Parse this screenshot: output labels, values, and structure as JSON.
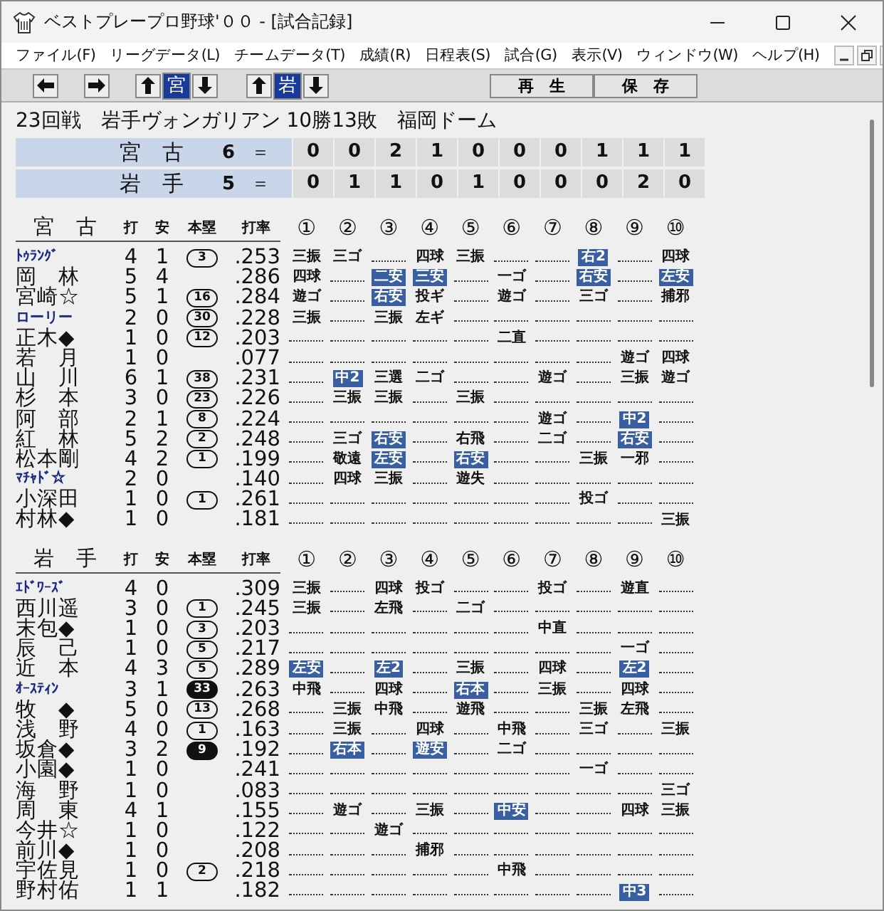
{
  "window": {
    "title": "ベストプレープロ野球'００ - [試合記録]"
  },
  "menu": {
    "items": [
      "ファイル(F)",
      "リーグデータ(L)",
      "チームデータ(T)",
      "成績(R)",
      "日程表(S)",
      "試合(G)",
      "表示(V)",
      "ウィンドウ(W)",
      "ヘルプ(H)"
    ]
  },
  "toolbar": {
    "teams": [
      {
        "label": "宮",
        "selected": true
      },
      {
        "label": "岩",
        "selected": true
      }
    ],
    "buttons": [
      "再　生",
      "保　存"
    ]
  },
  "game": {
    "header": "23回戦　岩手ヴォンガリアン 10勝13敗　福岡ドーム",
    "linescore": [
      {
        "team": "宮　古",
        "total": "6",
        "sign": "＝",
        "innings": [
          "0",
          "0",
          "2",
          "1",
          "0",
          "0",
          "0",
          "1",
          "1",
          "1"
        ]
      },
      {
        "team": "岩　手",
        "total": "5",
        "sign": "＝",
        "innings": [
          "0",
          "1",
          "1",
          "0",
          "1",
          "0",
          "0",
          "0",
          "2",
          "0"
        ]
      }
    ]
  },
  "batting": [
    {
      "team": "宮　古",
      "columns": [
        "打",
        "安",
        "本塁",
        "打率"
      ],
      "innings": [
        "①",
        "②",
        "③",
        "④",
        "⑤",
        "⑥",
        "⑦",
        "⑧",
        "⑨",
        "⑩"
      ],
      "players": [
        {
          "name": "ﾄｩﾗﾝｸﾞ",
          "foreign": true,
          "ab": "4",
          "h": "1",
          "hr": {
            "count": "3",
            "filled": false
          },
          "avg": ".253",
          "results": [
            {
              "kind": "out",
              "text": "三振"
            },
            {
              "kind": "out",
              "text": "三ゴ"
            },
            {
              "kind": "blank"
            },
            {
              "kind": "out",
              "text": "四球"
            },
            {
              "kind": "out",
              "text": "三振"
            },
            {
              "kind": "blank"
            },
            {
              "kind": "blank"
            },
            {
              "kind": "hit",
              "text": "右2"
            },
            {
              "kind": "blank"
            },
            {
              "kind": "out",
              "text": "四球"
            }
          ]
        },
        {
          "name": "岡　林",
          "foreign": false,
          "ab": "5",
          "h": "4",
          "avg": ".286",
          "results": [
            {
              "kind": "out",
              "text": "四球"
            },
            {
              "kind": "blank"
            },
            {
              "kind": "hit",
              "text": "二安"
            },
            {
              "kind": "hit",
              "text": "三安"
            },
            {
              "kind": "blank"
            },
            {
              "kind": "out",
              "text": "一ゴ"
            },
            {
              "kind": "blank"
            },
            {
              "kind": "hit",
              "text": "右安"
            },
            {
              "kind": "blank"
            },
            {
              "kind": "hit",
              "text": "左安"
            }
          ]
        },
        {
          "name": "宮崎☆",
          "foreign": false,
          "ab": "5",
          "h": "1",
          "hr": {
            "count": "16",
            "filled": false
          },
          "avg": ".284",
          "results": [
            {
              "kind": "out",
              "text": "遊ゴ"
            },
            {
              "kind": "blank"
            },
            {
              "kind": "hit",
              "text": "右安"
            },
            {
              "kind": "out",
              "text": "投ギ"
            },
            {
              "kind": "blank"
            },
            {
              "kind": "out",
              "text": "遊ゴ"
            },
            {
              "kind": "blank"
            },
            {
              "kind": "out",
              "text": "三ゴ"
            },
            {
              "kind": "blank"
            },
            {
              "kind": "out",
              "text": "捕邪"
            }
          ]
        },
        {
          "name": "ローリー",
          "foreign": true,
          "ab": "2",
          "h": "0",
          "hr": {
            "count": "30",
            "filled": false
          },
          "avg": ".228",
          "results": [
            {
              "kind": "out",
              "text": "三振"
            },
            {
              "kind": "blank"
            },
            {
              "kind": "out",
              "text": "三振"
            },
            {
              "kind": "out",
              "text": "左ギ"
            },
            {
              "kind": "blank"
            },
            {
              "kind": "blank"
            },
            {
              "kind": "blank"
            },
            {
              "kind": "blank"
            },
            {
              "kind": "blank"
            },
            {
              "kind": "blank"
            }
          ]
        },
        {
          "name": "正木◆",
          "foreign": false,
          "ab": "1",
          "h": "0",
          "hr": {
            "count": "12",
            "filled": false
          },
          "avg": ".203",
          "results": [
            {
              "kind": "blank"
            },
            {
              "kind": "blank"
            },
            {
              "kind": "blank"
            },
            {
              "kind": "blank"
            },
            {
              "kind": "blank"
            },
            {
              "kind": "out",
              "text": "二直"
            },
            {
              "kind": "blank"
            },
            {
              "kind": "blank"
            },
            {
              "kind": "blank"
            },
            {
              "kind": "blank"
            }
          ]
        },
        {
          "name": "若　月",
          "foreign": false,
          "ab": "1",
          "h": "0",
          "avg": ".077",
          "results": [
            {
              "kind": "blank"
            },
            {
              "kind": "blank"
            },
            {
              "kind": "blank"
            },
            {
              "kind": "blank"
            },
            {
              "kind": "blank"
            },
            {
              "kind": "blank"
            },
            {
              "kind": "blank"
            },
            {
              "kind": "blank"
            },
            {
              "kind": "out",
              "text": "遊ゴ"
            },
            {
              "kind": "out",
              "text": "四球"
            }
          ]
        },
        {
          "name": "山　川",
          "foreign": false,
          "ab": "6",
          "h": "1",
          "hr": {
            "count": "38",
            "filled": false
          },
          "avg": ".231",
          "results": [
            {
              "kind": "blank"
            },
            {
              "kind": "hit",
              "text": "中2"
            },
            {
              "kind": "out",
              "text": "三選"
            },
            {
              "kind": "out",
              "text": "二ゴ"
            },
            {
              "kind": "blank"
            },
            {
              "kind": "blank"
            },
            {
              "kind": "out",
              "text": "遊ゴ"
            },
            {
              "kind": "blank"
            },
            {
              "kind": "out",
              "text": "三振"
            },
            {
              "kind": "out",
              "text": "遊ゴ"
            }
          ]
        },
        {
          "name": "杉　本",
          "foreign": false,
          "ab": "3",
          "h": "0",
          "hr": {
            "count": "23",
            "filled": false
          },
          "avg": ".226",
          "results": [
            {
              "kind": "blank"
            },
            {
              "kind": "out",
              "text": "三振"
            },
            {
              "kind": "out",
              "text": "三振"
            },
            {
              "kind": "blank"
            },
            {
              "kind": "out",
              "text": "三振"
            },
            {
              "kind": "blank"
            },
            {
              "kind": "blank"
            },
            {
              "kind": "blank"
            },
            {
              "kind": "blank"
            },
            {
              "kind": "blank"
            }
          ]
        },
        {
          "name": "阿　部",
          "foreign": false,
          "ab": "2",
          "h": "1",
          "hr": {
            "count": "8",
            "filled": false
          },
          "avg": ".224",
          "results": [
            {
              "kind": "blank"
            },
            {
              "kind": "blank"
            },
            {
              "kind": "blank"
            },
            {
              "kind": "blank"
            },
            {
              "kind": "blank"
            },
            {
              "kind": "blank"
            },
            {
              "kind": "out",
              "text": "遊ゴ"
            },
            {
              "kind": "blank"
            },
            {
              "kind": "hit",
              "text": "中2"
            },
            {
              "kind": "blank"
            }
          ]
        },
        {
          "name": "紅　林",
          "foreign": false,
          "ab": "5",
          "h": "2",
          "hr": {
            "count": "2",
            "filled": false
          },
          "avg": ".248",
          "results": [
            {
              "kind": "blank"
            },
            {
              "kind": "out",
              "text": "三ゴ"
            },
            {
              "kind": "hit",
              "text": "右安"
            },
            {
              "kind": "blank"
            },
            {
              "kind": "out",
              "text": "右飛"
            },
            {
              "kind": "blank"
            },
            {
              "kind": "out",
              "text": "二ゴ"
            },
            {
              "kind": "blank"
            },
            {
              "kind": "hit",
              "text": "右安"
            },
            {
              "kind": "blank"
            }
          ]
        },
        {
          "name": "松本剛",
          "foreign": false,
          "ab": "4",
          "h": "2",
          "hr": {
            "count": "1",
            "filled": false
          },
          "avg": ".199",
          "results": [
            {
              "kind": "blank"
            },
            {
              "kind": "out",
              "text": "敬遠"
            },
            {
              "kind": "hit",
              "text": "左安"
            },
            {
              "kind": "blank"
            },
            {
              "kind": "hit",
              "text": "右安"
            },
            {
              "kind": "blank"
            },
            {
              "kind": "blank"
            },
            {
              "kind": "out",
              "text": "三振"
            },
            {
              "kind": "out",
              "text": "一邪"
            },
            {
              "kind": "blank"
            }
          ]
        },
        {
          "name": "ﾏﾁｬﾄﾞ☆",
          "foreign": true,
          "ab": "2",
          "h": "0",
          "avg": ".140",
          "results": [
            {
              "kind": "blank"
            },
            {
              "kind": "out",
              "text": "四球"
            },
            {
              "kind": "out",
              "text": "三振"
            },
            {
              "kind": "blank"
            },
            {
              "kind": "out",
              "text": "遊失"
            },
            {
              "kind": "blank"
            },
            {
              "kind": "blank"
            },
            {
              "kind": "blank"
            },
            {
              "kind": "blank"
            },
            {
              "kind": "blank"
            }
          ]
        },
        {
          "name": "小深田",
          "foreign": false,
          "ab": "1",
          "h": "0",
          "hr": {
            "count": "1",
            "filled": false
          },
          "avg": ".261",
          "results": [
            {
              "kind": "blank"
            },
            {
              "kind": "blank"
            },
            {
              "kind": "blank"
            },
            {
              "kind": "blank"
            },
            {
              "kind": "blank"
            },
            {
              "kind": "blank"
            },
            {
              "kind": "blank"
            },
            {
              "kind": "out",
              "text": "投ゴ"
            },
            {
              "kind": "blank"
            },
            {
              "kind": "blank"
            }
          ]
        },
        {
          "name": "村林◆",
          "foreign": false,
          "ab": "1",
          "h": "0",
          "avg": ".181",
          "results": [
            {
              "kind": "blank"
            },
            {
              "kind": "blank"
            },
            {
              "kind": "blank"
            },
            {
              "kind": "blank"
            },
            {
              "kind": "blank"
            },
            {
              "kind": "blank"
            },
            {
              "kind": "blank"
            },
            {
              "kind": "blank"
            },
            {
              "kind": "blank"
            },
            {
              "kind": "out",
              "text": "三振"
            }
          ]
        }
      ]
    },
    {
      "team": "岩　手",
      "columns": [
        "打",
        "安",
        "本塁",
        "打率"
      ],
      "innings": [
        "①",
        "②",
        "③",
        "④",
        "⑤",
        "⑥",
        "⑦",
        "⑧",
        "⑨",
        "⑩"
      ],
      "players": [
        {
          "name": "ｴﾄﾞﾜｰｽﾞ",
          "foreign": true,
          "ab": "4",
          "h": "0",
          "avg": ".309",
          "results": [
            {
              "kind": "out",
              "text": "三振"
            },
            {
              "kind": "blank"
            },
            {
              "kind": "out",
              "text": "四球"
            },
            {
              "kind": "out",
              "text": "投ゴ"
            },
            {
              "kind": "blank"
            },
            {
              "kind": "blank"
            },
            {
              "kind": "out",
              "text": "投ゴ"
            },
            {
              "kind": "blank"
            },
            {
              "kind": "out",
              "text": "遊直"
            },
            {
              "kind": "blank"
            }
          ]
        },
        {
          "name": "西川遥",
          "foreign": false,
          "ab": "3",
          "h": "0",
          "hr": {
            "count": "1",
            "filled": false
          },
          "avg": ".245",
          "results": [
            {
              "kind": "out",
              "text": "三振"
            },
            {
              "kind": "blank"
            },
            {
              "kind": "out",
              "text": "左飛"
            },
            {
              "kind": "blank"
            },
            {
              "kind": "out",
              "text": "二ゴ"
            },
            {
              "kind": "blank"
            },
            {
              "kind": "blank"
            },
            {
              "kind": "blank"
            },
            {
              "kind": "blank"
            },
            {
              "kind": "blank"
            }
          ]
        },
        {
          "name": "末包◆",
          "foreign": false,
          "ab": "1",
          "h": "0",
          "hr": {
            "count": "3",
            "filled": false
          },
          "avg": ".203",
          "results": [
            {
              "kind": "blank"
            },
            {
              "kind": "blank"
            },
            {
              "kind": "blank"
            },
            {
              "kind": "blank"
            },
            {
              "kind": "blank"
            },
            {
              "kind": "blank"
            },
            {
              "kind": "out",
              "text": "中直"
            },
            {
              "kind": "blank"
            },
            {
              "kind": "blank"
            },
            {
              "kind": "blank"
            }
          ]
        },
        {
          "name": "辰　己",
          "foreign": false,
          "ab": "1",
          "h": "0",
          "hr": {
            "count": "5",
            "filled": false
          },
          "avg": ".217",
          "results": [
            {
              "kind": "blank"
            },
            {
              "kind": "blank"
            },
            {
              "kind": "blank"
            },
            {
              "kind": "blank"
            },
            {
              "kind": "blank"
            },
            {
              "kind": "blank"
            },
            {
              "kind": "blank"
            },
            {
              "kind": "blank"
            },
            {
              "kind": "out",
              "text": "一ゴ"
            },
            {
              "kind": "blank"
            }
          ]
        },
        {
          "name": "近　本",
          "foreign": false,
          "ab": "4",
          "h": "3",
          "hr": {
            "count": "5",
            "filled": false
          },
          "avg": ".289",
          "results": [
            {
              "kind": "hit",
              "text": "左安"
            },
            {
              "kind": "blank"
            },
            {
              "kind": "hit",
              "text": "左2"
            },
            {
              "kind": "blank"
            },
            {
              "kind": "out",
              "text": "三振"
            },
            {
              "kind": "blank"
            },
            {
              "kind": "out",
              "text": "四球"
            },
            {
              "kind": "blank"
            },
            {
              "kind": "hit",
              "text": "左2"
            },
            {
              "kind": "blank"
            }
          ]
        },
        {
          "name": "ｵｰｽﾃｨﾝ",
          "foreign": true,
          "ab": "3",
          "h": "1",
          "hr": {
            "count": "33",
            "filled": true
          },
          "avg": ".263",
          "results": [
            {
              "kind": "out",
              "text": "中飛"
            },
            {
              "kind": "blank"
            },
            {
              "kind": "out",
              "text": "四球"
            },
            {
              "kind": "blank"
            },
            {
              "kind": "hit",
              "text": "右本"
            },
            {
              "kind": "blank"
            },
            {
              "kind": "out",
              "text": "三振"
            },
            {
              "kind": "blank"
            },
            {
              "kind": "out",
              "text": "四球"
            },
            {
              "kind": "blank"
            }
          ]
        },
        {
          "name": "牧　◆",
          "foreign": false,
          "ab": "5",
          "h": "0",
          "hr": {
            "count": "13",
            "filled": false
          },
          "avg": ".268",
          "results": [
            {
              "kind": "blank"
            },
            {
              "kind": "out",
              "text": "三振"
            },
            {
              "kind": "out",
              "text": "中飛"
            },
            {
              "kind": "blank"
            },
            {
              "kind": "out",
              "text": "遊飛"
            },
            {
              "kind": "blank"
            },
            {
              "kind": "blank"
            },
            {
              "kind": "out",
              "text": "三振"
            },
            {
              "kind": "out",
              "text": "左飛"
            },
            {
              "kind": "blank"
            }
          ]
        },
        {
          "name": "浅　野",
          "foreign": false,
          "ab": "4",
          "h": "0",
          "hr": {
            "count": "1",
            "filled": false
          },
          "avg": ".163",
          "results": [
            {
              "kind": "blank"
            },
            {
              "kind": "out",
              "text": "三振"
            },
            {
              "kind": "blank"
            },
            {
              "kind": "out",
              "text": "四球"
            },
            {
              "kind": "blank"
            },
            {
              "kind": "out",
              "text": "中飛"
            },
            {
              "kind": "blank"
            },
            {
              "kind": "out",
              "text": "三ゴ"
            },
            {
              "kind": "blank"
            },
            {
              "kind": "out",
              "text": "三振"
            }
          ]
        },
        {
          "name": "坂倉◆",
          "foreign": false,
          "ab": "3",
          "h": "2",
          "hr": {
            "count": "9",
            "filled": true
          },
          "avg": ".192",
          "results": [
            {
              "kind": "blank"
            },
            {
              "kind": "hit",
              "text": "右本"
            },
            {
              "kind": "blank"
            },
            {
              "kind": "hit",
              "text": "遊安"
            },
            {
              "kind": "blank"
            },
            {
              "kind": "out",
              "text": "二ゴ"
            },
            {
              "kind": "blank"
            },
            {
              "kind": "blank"
            },
            {
              "kind": "blank"
            },
            {
              "kind": "blank"
            }
          ]
        },
        {
          "name": "小園◆",
          "foreign": false,
          "ab": "1",
          "h": "0",
          "avg": ".241",
          "results": [
            {
              "kind": "blank"
            },
            {
              "kind": "blank"
            },
            {
              "kind": "blank"
            },
            {
              "kind": "blank"
            },
            {
              "kind": "blank"
            },
            {
              "kind": "blank"
            },
            {
              "kind": "blank"
            },
            {
              "kind": "out",
              "text": "一ゴ"
            },
            {
              "kind": "blank"
            },
            {
              "kind": "blank"
            }
          ]
        },
        {
          "name": "海　野",
          "foreign": false,
          "ab": "1",
          "h": "0",
          "avg": ".083",
          "results": [
            {
              "kind": "blank"
            },
            {
              "kind": "blank"
            },
            {
              "kind": "blank"
            },
            {
              "kind": "blank"
            },
            {
              "kind": "blank"
            },
            {
              "kind": "blank"
            },
            {
              "kind": "blank"
            },
            {
              "kind": "blank"
            },
            {
              "kind": "blank"
            },
            {
              "kind": "out",
              "text": "三ゴ"
            }
          ]
        },
        {
          "name": "周　東",
          "foreign": false,
          "ab": "4",
          "h": "1",
          "avg": ".155",
          "results": [
            {
              "kind": "blank"
            },
            {
              "kind": "out",
              "text": "遊ゴ"
            },
            {
              "kind": "blank"
            },
            {
              "kind": "out",
              "text": "三振"
            },
            {
              "kind": "blank"
            },
            {
              "kind": "hit",
              "text": "中安"
            },
            {
              "kind": "blank"
            },
            {
              "kind": "blank"
            },
            {
              "kind": "out",
              "text": "四球"
            },
            {
              "kind": "out",
              "text": "三振"
            }
          ]
        },
        {
          "name": "今井☆",
          "foreign": false,
          "ab": "1",
          "h": "0",
          "avg": ".122",
          "results": [
            {
              "kind": "blank"
            },
            {
              "kind": "blank"
            },
            {
              "kind": "out",
              "text": "遊ゴ"
            },
            {
              "kind": "blank"
            },
            {
              "kind": "blank"
            },
            {
              "kind": "blank"
            },
            {
              "kind": "blank"
            },
            {
              "kind": "blank"
            },
            {
              "kind": "blank"
            },
            {
              "kind": "blank"
            }
          ]
        },
        {
          "name": "前川◆",
          "foreign": false,
          "ab": "1",
          "h": "0",
          "avg": ".208",
          "results": [
            {
              "kind": "blank"
            },
            {
              "kind": "blank"
            },
            {
              "kind": "blank"
            },
            {
              "kind": "out",
              "text": "捕邪"
            },
            {
              "kind": "blank"
            },
            {
              "kind": "blank"
            },
            {
              "kind": "blank"
            },
            {
              "kind": "blank"
            },
            {
              "kind": "blank"
            },
            {
              "kind": "blank"
            }
          ]
        },
        {
          "name": "宇佐見",
          "foreign": false,
          "ab": "1",
          "h": "0",
          "hr": {
            "count": "2",
            "filled": false
          },
          "avg": ".218",
          "results": [
            {
              "kind": "blank"
            },
            {
              "kind": "blank"
            },
            {
              "kind": "blank"
            },
            {
              "kind": "blank"
            },
            {
              "kind": "blank"
            },
            {
              "kind": "out",
              "text": "中飛"
            },
            {
              "kind": "blank"
            },
            {
              "kind": "blank"
            },
            {
              "kind": "blank"
            },
            {
              "kind": "blank"
            }
          ]
        },
        {
          "name": "野村佑",
          "foreign": false,
          "ab": "1",
          "h": "1",
          "avg": ".182",
          "results": [
            {
              "kind": "blank"
            },
            {
              "kind": "blank"
            },
            {
              "kind": "blank"
            },
            {
              "kind": "blank"
            },
            {
              "kind": "blank"
            },
            {
              "kind": "blank"
            },
            {
              "kind": "blank"
            },
            {
              "kind": "blank"
            },
            {
              "kind": "hit",
              "text": "中3"
            },
            {
              "kind": "blank"
            }
          ]
        }
      ]
    }
  ]
}
